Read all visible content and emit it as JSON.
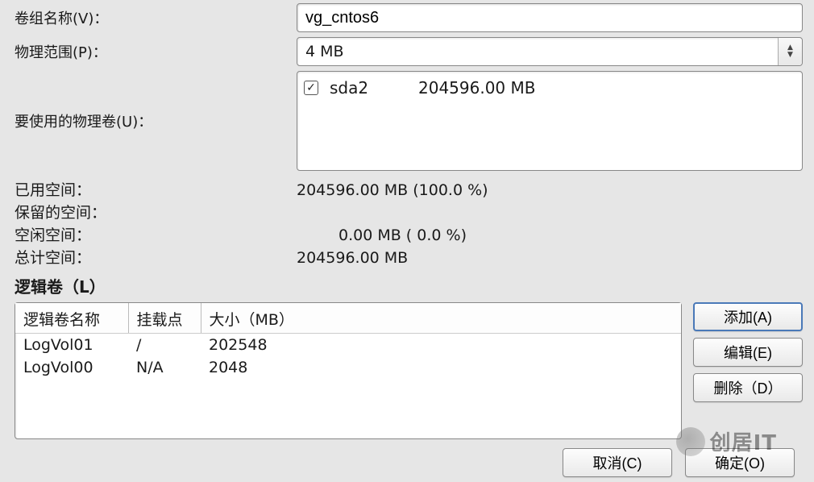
{
  "fields": {
    "vg_name_label": "卷组名称(V)：",
    "vg_name_value": "vg_cntos6",
    "pe_label": "物理范围(P)：",
    "pe_value": "4 MB",
    "pv_use_label": "要使用的物理卷(U)："
  },
  "pv_list": [
    {
      "checked": true,
      "name": "sda2",
      "size": "204596.00 MB"
    }
  ],
  "stats": {
    "used_label": "已用空间：",
    "used_value": "204596.00 MB   (100.0 %)",
    "reserved_label": "保留的空间：",
    "free_label": "空闲空间：",
    "free_value": "0.00 MB   ( 0.0 %)",
    "total_label": "总计空间：",
    "total_value": "204596.00 MB"
  },
  "lv_section_title": "逻辑卷（L）",
  "lv_headers": {
    "name": "逻辑卷名称",
    "mount": "挂载点",
    "size": "大小（MB）"
  },
  "lv_rows": [
    {
      "name": "LogVol01",
      "mount": "/",
      "size": "202548"
    },
    {
      "name": "LogVol00",
      "mount": "N/A",
      "size": "2048"
    }
  ],
  "buttons": {
    "add": "添加(A)",
    "edit": "编辑(E)",
    "delete": "删除（D）",
    "cancel": "取消(C)",
    "ok": "确定(O)"
  },
  "watermark": "创居IT"
}
